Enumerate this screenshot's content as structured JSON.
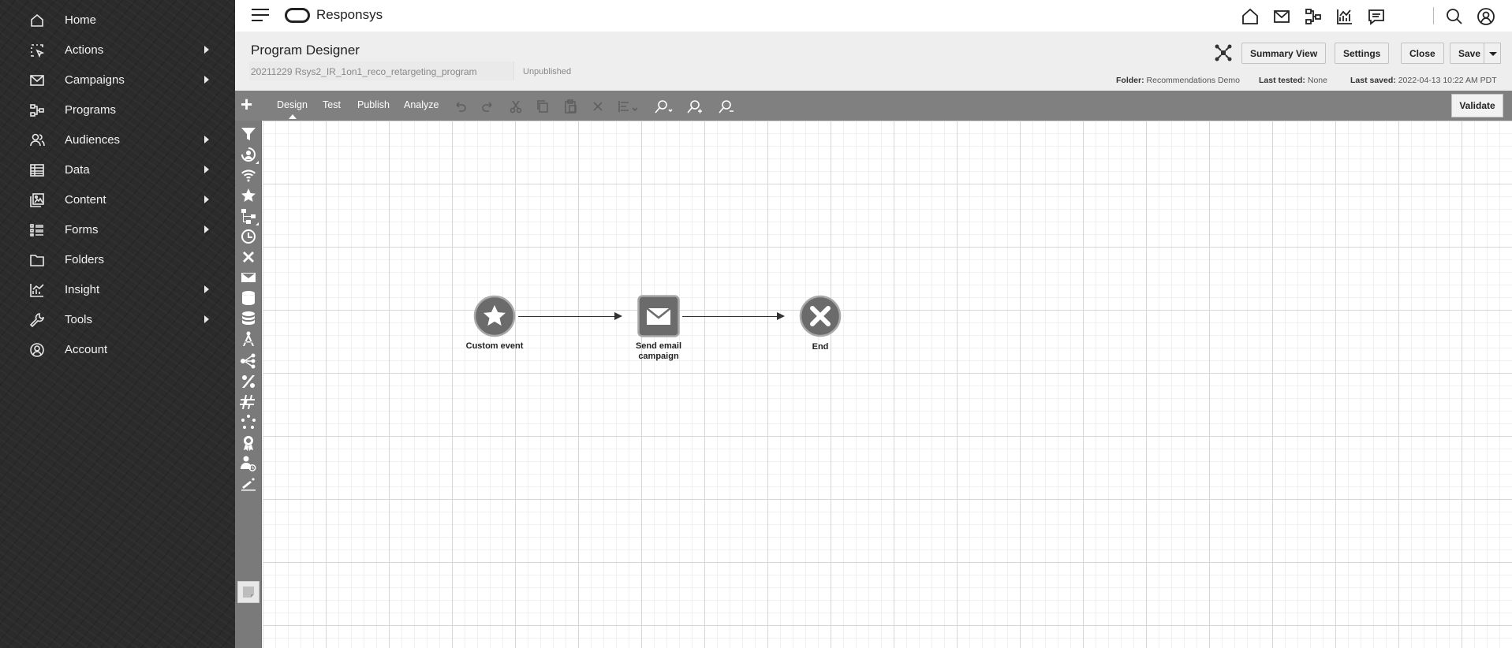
{
  "sidebar": {
    "items": [
      {
        "label": "Home",
        "icon": "home-icon",
        "has_submenu": false
      },
      {
        "label": "Actions",
        "icon": "cursor-select-icon",
        "has_submenu": true
      },
      {
        "label": "Campaigns",
        "icon": "envelope-icon",
        "has_submenu": true
      },
      {
        "label": "Programs",
        "icon": "program-flow-icon",
        "has_submenu": false
      },
      {
        "label": "Audiences",
        "icon": "people-icon",
        "has_submenu": true
      },
      {
        "label": "Data",
        "icon": "table-icon",
        "has_submenu": true
      },
      {
        "label": "Content",
        "icon": "image-icon",
        "has_submenu": true
      },
      {
        "label": "Forms",
        "icon": "form-list-icon",
        "has_submenu": true
      },
      {
        "label": "Folders",
        "icon": "folder-icon",
        "has_submenu": false
      },
      {
        "label": "Insight",
        "icon": "chart-icon",
        "has_submenu": true
      },
      {
        "label": "Tools",
        "icon": "wrench-icon",
        "has_submenu": true
      },
      {
        "label": "Account",
        "icon": "user-circle-icon",
        "has_submenu": false
      }
    ]
  },
  "header": {
    "brand": "Responsys",
    "icons": [
      "home-icon",
      "envelope-icon",
      "program-flow-icon",
      "chart-icon",
      "message-icon",
      "search-icon",
      "user-circle-icon"
    ]
  },
  "program": {
    "title": "Program Designer",
    "name": "20211229 Rsys2_IR_1on1_reco_retargeting_program",
    "status": "Unpublished",
    "buttons": {
      "summary": "Summary View",
      "settings": "Settings",
      "close": "Close",
      "save": "Save"
    },
    "meta": {
      "folder_label": "Folder:",
      "folder_value": "Recommendations Demo",
      "tested_label": "Last tested:",
      "tested_value": "None",
      "saved_label": "Last saved:",
      "saved_value": "2022-04-13 10:22 AM PDT"
    }
  },
  "toolbar": {
    "tabs": [
      "Design",
      "Test",
      "Publish",
      "Analyze"
    ],
    "active_tab": "Design",
    "validate_label": "Validate"
  },
  "canvas": {
    "nodes": [
      {
        "label": "Custom event",
        "icon": "star-icon"
      },
      {
        "label": "Send email campaign",
        "icon": "envelope-icon"
      },
      {
        "label": "End",
        "icon": "close-icon"
      }
    ]
  },
  "colors": {
    "sidebar_bg": "#2b2b2b",
    "toolbar_bg": "#808080",
    "header_bg": "#eeeeee",
    "node_fill": "#6b6b6b"
  }
}
